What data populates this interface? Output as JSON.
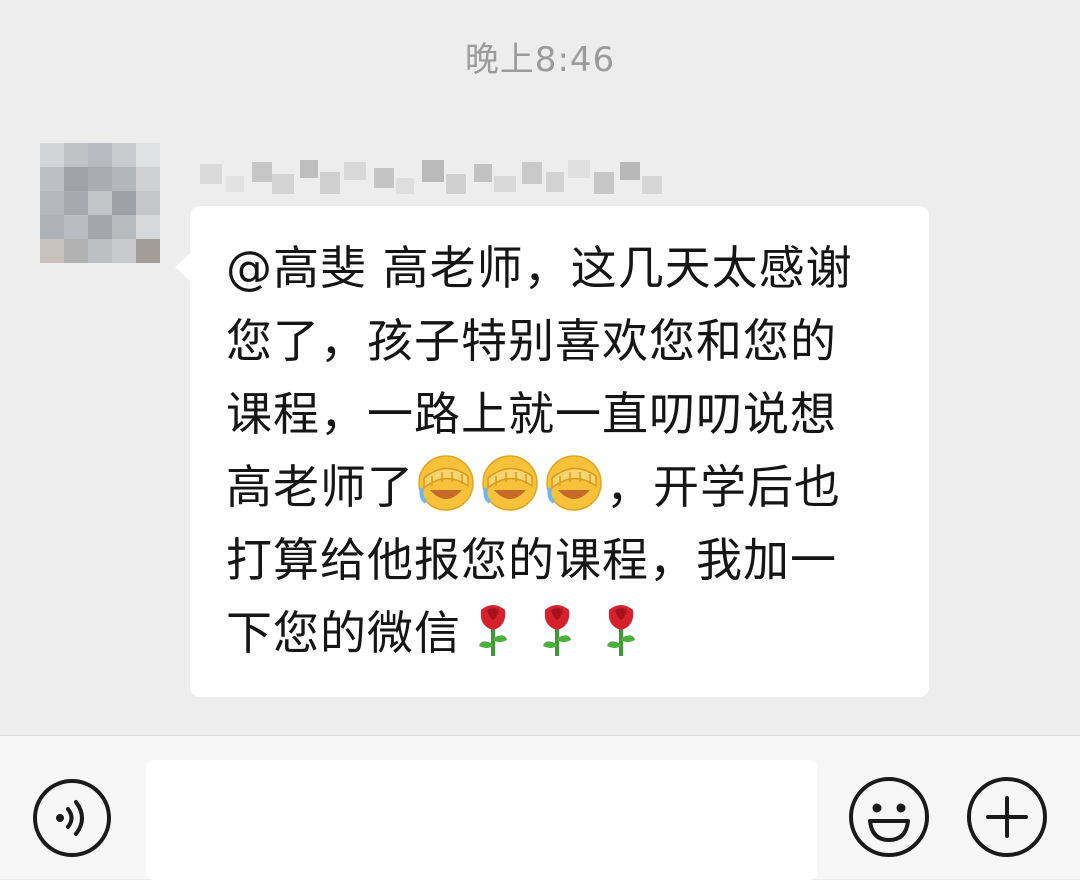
{
  "chat": {
    "timestamp": "晚上8:46",
    "message": {
      "lines": [
        {
          "text": "@高斐  高老师，这几天太感谢"
        },
        {
          "text": "您了，孩子特别喜欢您和您的"
        },
        {
          "text": "课程，一路上就一直叨叨说想"
        },
        {
          "text": "高老师了",
          "after_emoji": "，开学后也",
          "emoji": "facepalm-emoji",
          "emoji_count": 3
        },
        {
          "text": "打算给他报您的课程，我加一"
        },
        {
          "text": "下您的微信",
          "emoji": "rose-emoji",
          "emoji_count": 3
        }
      ]
    }
  },
  "input_bar": {
    "input_value": "",
    "voice_icon": "voice-icon",
    "emoji_icon": "smiley-face-icon",
    "more_icon": "plus-icon"
  },
  "colors": {
    "background": "#ededed",
    "bubble": "#ffffff",
    "text": "#151515",
    "timestamp": "#9b9b9b",
    "icon": "#1a1a1a"
  }
}
